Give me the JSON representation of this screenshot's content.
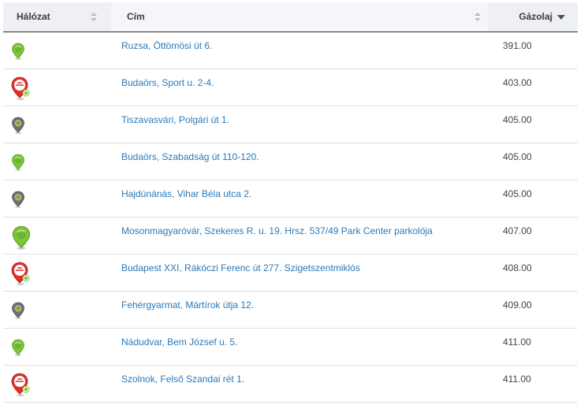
{
  "columns": {
    "network": "Hálózat",
    "address": "Cím",
    "price": "Gázolaj"
  },
  "colors": {
    "green": "#7cc43a",
    "gray": "#8a8c6c",
    "red": "#e0302b",
    "link": "#2a79b8"
  },
  "rows": [
    {
      "network_icon": "green-pin-icon",
      "address": "Ruzsa, Öttömösi út 6.",
      "price": "391.00"
    },
    {
      "network_icon": "red-brand-pin-icon",
      "address": "Budaörs, Sport u. 2-4.",
      "price": "403.00"
    },
    {
      "network_icon": "gray-pin-icon",
      "address": "Tiszavasvári, Polgári út 1.",
      "price": "405.00"
    },
    {
      "network_icon": "green-pin-icon",
      "address": "Budaörs, Szabadság út 110-120.",
      "price": "405.00"
    },
    {
      "network_icon": "gray-pin-icon",
      "address": "Hajdúnánás, Vihar Béla utca 2.",
      "price": "405.00"
    },
    {
      "network_icon": "green-pin-large-icon",
      "address": "Mosonmagyaróvár, Szekeres R. u. 19. Hrsz. 537/49 Park Center parkolója",
      "price": "407.00"
    },
    {
      "network_icon": "red-brand-pin-icon",
      "address": "Budapest XXI, Rákóczi Ferenc út 277. Szigetszentmiklós",
      "price": "408.00"
    },
    {
      "network_icon": "gray-pin-icon",
      "address": "Fehérgyarmat, Mártírok útja 12.",
      "price": "409.00"
    },
    {
      "network_icon": "green-pin-icon",
      "address": "Nádudvar, Bem József u. 5.",
      "price": "411.00"
    },
    {
      "network_icon": "red-brand-pin-icon",
      "address": "Szolnok, Felső Szandai rét 1.",
      "price": "411.00"
    }
  ]
}
